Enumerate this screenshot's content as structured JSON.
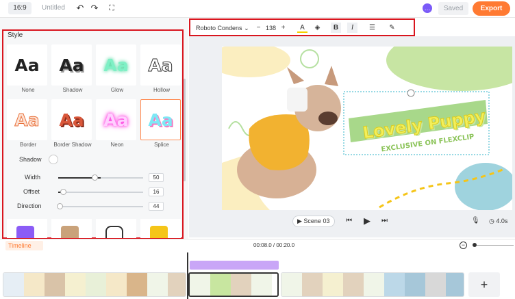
{
  "topbar": {
    "ratio": "16:9",
    "doc_title": "Untitled",
    "undo_icon": "undo-icon",
    "redo_icon": "redo-icon",
    "fullscreen_icon": "fullscreen-icon",
    "help_icon": "help-icon",
    "saved_label": "Saved",
    "export_label": "Export",
    "export_color": "#ff7a32"
  },
  "style_panel": {
    "title": "Style",
    "styles": [
      {
        "label": "None",
        "sample": "Aa"
      },
      {
        "label": "Shadow",
        "sample": "Aa"
      },
      {
        "label": "Glow",
        "sample": "Aa"
      },
      {
        "label": "Hollow",
        "sample": "Aa"
      },
      {
        "label": "Border",
        "sample": "Aa"
      },
      {
        "label": "Border Shadow",
        "sample": "Aa"
      },
      {
        "label": "Neon",
        "sample": "Aa"
      },
      {
        "label": "Splice",
        "sample": "Aa"
      }
    ],
    "selected_style": "Splice",
    "shadow_label": "Shadow",
    "sliders": [
      {
        "label": "Width",
        "value": "50",
        "fraction": 0.5
      },
      {
        "label": "Offset",
        "value": "16",
        "fraction": 0.16
      },
      {
        "label": "Direction",
        "value": "44",
        "fraction": 0.12
      }
    ]
  },
  "text_toolbar": {
    "font_name": "Roboto Condens",
    "minus": "−",
    "font_size": "138",
    "plus": "+",
    "bold": "B",
    "italic": "I"
  },
  "canvas": {
    "headline": "Lovely Puppy",
    "subline": "EXCLUSIVE ON FLEXCLIP"
  },
  "playback": {
    "scene_label": "Scene 03",
    "duration": "4.0s"
  },
  "timeline": {
    "label": "Timeline",
    "time": "00:08.0 / 00:20.0",
    "add_label": "+"
  },
  "colors": {
    "accent": "#ff7a32",
    "highlight_outline": "#d9151e",
    "text_layer_purple": "#c9a6f7",
    "headline_yellow": "#f3ef5a",
    "banner_green": "#a8d88a"
  }
}
